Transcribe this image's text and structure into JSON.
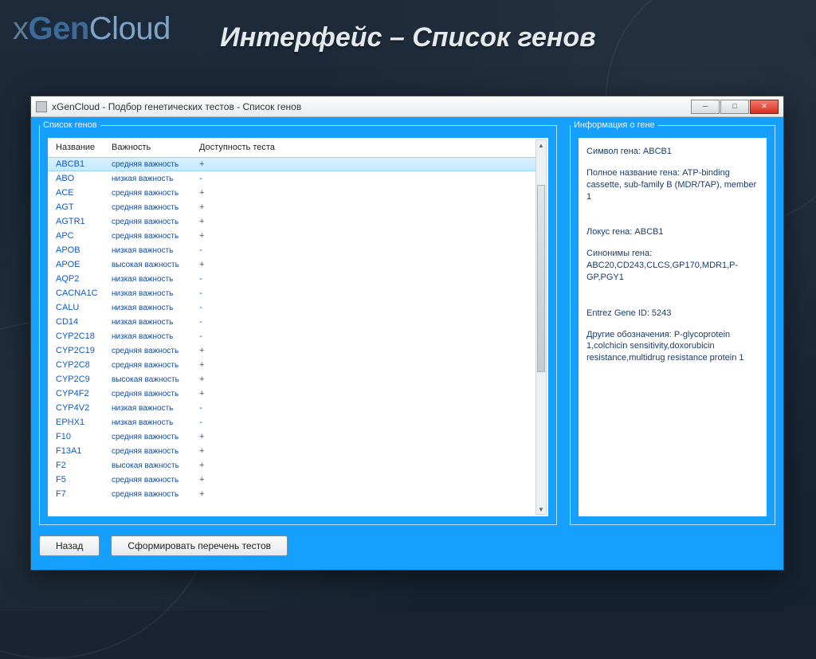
{
  "logo": {
    "x": "x",
    "gen": "Gen",
    "cloud": "Cloud"
  },
  "slide_title": "Интерфейс – Список генов",
  "window": {
    "title": "xGenCloud - Подбор генетических тестов - Список генов"
  },
  "panels": {
    "list_legend": "Список генов",
    "info_legend": "Информация о гене"
  },
  "columns": {
    "name": "Название",
    "importance": "Важность",
    "availability": "Доступность теста"
  },
  "rows": [
    {
      "name": "ABCB1",
      "importance": "средняя важность",
      "avail": "+",
      "selected": true
    },
    {
      "name": "ABO",
      "importance": "низкая важность",
      "avail": "-"
    },
    {
      "name": "ACE",
      "importance": "средняя важность",
      "avail": "+"
    },
    {
      "name": "AGT",
      "importance": "средняя важность",
      "avail": "+"
    },
    {
      "name": "AGTR1",
      "importance": "средняя важность",
      "avail": "+"
    },
    {
      "name": "APC",
      "importance": "средняя важность",
      "avail": "+"
    },
    {
      "name": "APOB",
      "importance": "низкая важность",
      "avail": "-"
    },
    {
      "name": "APOE",
      "importance": "высокая важность",
      "avail": "+"
    },
    {
      "name": "AQP2",
      "importance": "низкая важность",
      "avail": "-"
    },
    {
      "name": "CACNA1C",
      "importance": "низкая важность",
      "avail": "-"
    },
    {
      "name": "CALU",
      "importance": "низкая важность",
      "avail": "-"
    },
    {
      "name": "CD14",
      "importance": "низкая важность",
      "avail": "-"
    },
    {
      "name": "CYP2C18",
      "importance": "низкая важность",
      "avail": "-"
    },
    {
      "name": "CYP2C19",
      "importance": "средняя важность",
      "avail": "+"
    },
    {
      "name": "CYP2C8",
      "importance": "средняя важность",
      "avail": "+"
    },
    {
      "name": "CYP2C9",
      "importance": "высокая важность",
      "avail": "+"
    },
    {
      "name": "CYP4F2",
      "importance": "средняя важность",
      "avail": "+"
    },
    {
      "name": "CYP4V2",
      "importance": "низкая важность",
      "avail": "-"
    },
    {
      "name": "EPHX1",
      "importance": "низкая важность",
      "avail": "-"
    },
    {
      "name": "F10",
      "importance": "средняя важность",
      "avail": "+"
    },
    {
      "name": "F13A1",
      "importance": "средняя важность",
      "avail": "+"
    },
    {
      "name": "F2",
      "importance": "высокая важность",
      "avail": "+"
    },
    {
      "name": "F5",
      "importance": "средняя важность",
      "avail": "+"
    },
    {
      "name": "F7",
      "importance": "средняя важность",
      "avail": "+"
    }
  ],
  "info": {
    "symbol": "Символ гена: ABCB1",
    "fullname": "Полное название гена: ATP-binding cassette, sub-family B (MDR/TAP), member 1",
    "locus": "Локус гена: ABCB1",
    "synonyms": "Синонимы гена: ABC20,CD243,CLCS,GP170,MDR1,P-GP,PGY1",
    "entrez": "Entrez Gene ID: 5243",
    "other": "Другие обозначения: P-glycoprotein 1,colchicin sensitivity,doxorubicin resistance,multidrug resistance protein 1"
  },
  "buttons": {
    "back": "Назад",
    "build": "Сформировать перечень тестов"
  }
}
